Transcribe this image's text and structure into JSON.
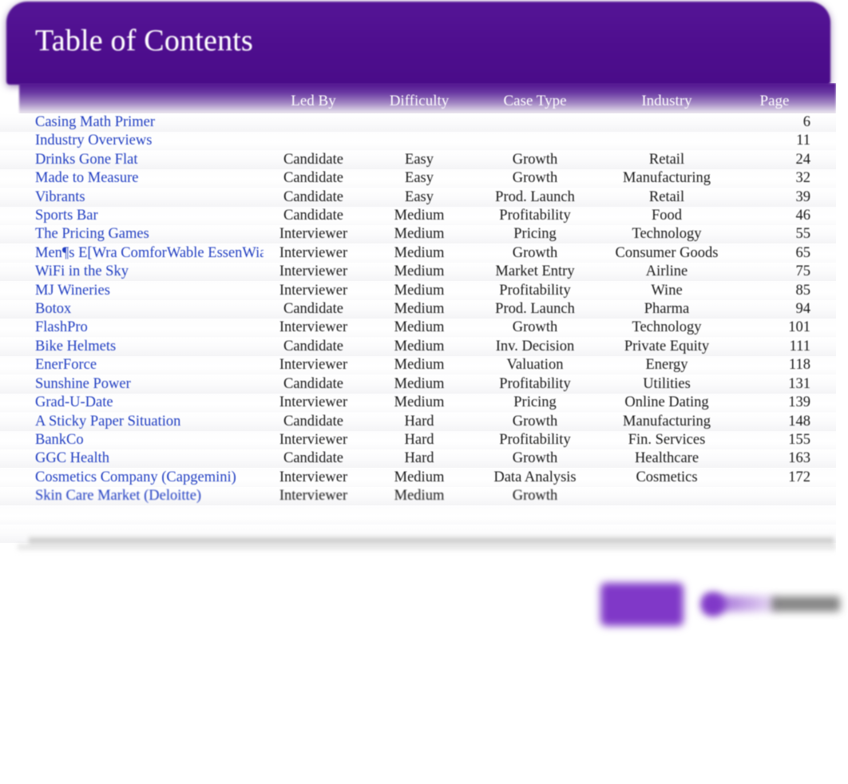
{
  "banner": {
    "title": "Table of Contents",
    "background_color": "#4e0e8e"
  },
  "table": {
    "columns": [
      "",
      "Led By",
      "Difficulty",
      "Case Type",
      "Industry",
      "Page"
    ],
    "link_color": "#2340c2",
    "rows": [
      {
        "name": "Casing Math Primer",
        "led_by": "",
        "difficulty": "",
        "case_type": "",
        "industry": "",
        "page": "6"
      },
      {
        "name": "Industry Overviews",
        "led_by": "",
        "difficulty": "",
        "case_type": "",
        "industry": "",
        "page": "11"
      },
      {
        "name": "Drinks  Gone Flat",
        "led_by": "Candidate",
        "difficulty": "Easy",
        "case_type": "Growth",
        "industry": "Retail",
        "page": "24"
      },
      {
        "name": "Made to Measure",
        "led_by": "Candidate",
        "difficulty": "Easy",
        "case_type": "Growth",
        "industry": "Manufacturing",
        "page": "32"
      },
      {
        "name": "Vibrants",
        "led_by": "Candidate",
        "difficulty": "Easy",
        "case_type": "Prod. Launch",
        "industry": "Retail",
        "page": "39"
      },
      {
        "name": "Sports Bar",
        "led_by": "Candidate",
        "difficulty": "Medium",
        "case_type": "Profitability",
        "industry": "Food",
        "page": "46"
      },
      {
        "name": "The Pricing Games",
        "led_by": "Interviewer",
        "difficulty": "Medium",
        "case_type": "Pricing",
        "industry": "Technology",
        "page": "55"
      },
      {
        "name": "Men¶s E[Wra ComforWable EssenWials",
        "led_by": "Interviewer",
        "difficulty": "Medium",
        "case_type": "Growth",
        "industry": "Consumer Goods",
        "page": "65"
      },
      {
        "name": "WiFi in the Sky",
        "led_by": "Interviewer",
        "difficulty": "Medium",
        "case_type": "Market Entry",
        "industry": "Airline",
        "page": "75"
      },
      {
        "name": "MJ Wineries",
        "led_by": "Interviewer",
        "difficulty": "Medium",
        "case_type": "Profitability",
        "industry": "Wine",
        "page": "85"
      },
      {
        "name": "Botox",
        "led_by": "Candidate",
        "difficulty": "Medium",
        "case_type": "Prod. Launch",
        "industry": "Pharma",
        "page": "94"
      },
      {
        "name": "FlashPro",
        "led_by": "Interviewer",
        "difficulty": "Medium",
        "case_type": "Growth",
        "industry": "Technology",
        "page": "101"
      },
      {
        "name": "Bike Helmets",
        "led_by": "Candidate",
        "difficulty": "Medium",
        "case_type": "Inv. Decision",
        "industry": "Private Equity",
        "page": "111"
      },
      {
        "name": "EnerForce",
        "led_by": "Interviewer",
        "difficulty": "Medium",
        "case_type": "Valuation",
        "industry": "Energy",
        "page": "118"
      },
      {
        "name": "Sunshine Power",
        "led_by": "Candidate",
        "difficulty": "Medium",
        "case_type": "Profitability",
        "industry": "Utilities",
        "page": "131"
      },
      {
        "name": "Grad-U-Date",
        "led_by": "Interviewer",
        "difficulty": "Medium",
        "case_type": "Pricing",
        "industry": "Online Dating",
        "page": "139"
      },
      {
        "name": "A Sticky Paper Situation",
        "led_by": "Candidate",
        "difficulty": "Hard",
        "case_type": "Growth",
        "industry": "Manufacturing",
        "page": "148"
      },
      {
        "name": "BankCo",
        "led_by": "Interviewer",
        "difficulty": "Hard",
        "case_type": "Profitability",
        "industry": "Fin. Services",
        "page": "155"
      },
      {
        "name": "GGC Health",
        "led_by": "Candidate",
        "difficulty": "Hard",
        "case_type": "Growth",
        "industry": "Healthcare",
        "page": "163"
      },
      {
        "name": "Cosmetics Company (Capgemini)",
        "led_by": "Interviewer",
        "difficulty": "Medium",
        "case_type": "Data Analysis",
        "industry": "Cosmetics",
        "page": "172"
      },
      {
        "name": "Skin Care Market (Deloitte)",
        "led_by": "Interviewer",
        "difficulty": "Medium",
        "case_type": "Growth",
        "industry": "",
        "page": ""
      },
      {
        "name": "",
        "led_by": "",
        "difficulty": "",
        "case_type": "",
        "industry": "",
        "page": ""
      },
      {
        "name": "",
        "led_by": "",
        "difficulty": "",
        "case_type": "",
        "industry": "",
        "page": ""
      }
    ]
  }
}
